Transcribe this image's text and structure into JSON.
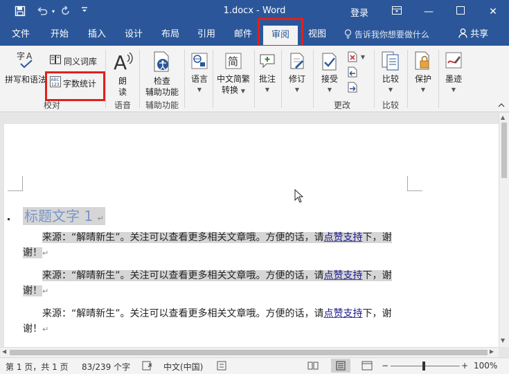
{
  "window": {
    "title": "1.docx  -  Word",
    "login_label": "登录",
    "minimize_glyph": "—",
    "maximize_glyph": "☐",
    "close_glyph": "✕",
    "ribbon_options_glyph": "⊡"
  },
  "quick_access": {
    "save_icon": "save-icon",
    "undo_icon": "undo-icon",
    "redo_icon": "redo-icon",
    "customize_icon": "customize-icon"
  },
  "tabs": [
    {
      "label": "文件"
    },
    {
      "label": "开始"
    },
    {
      "label": "插入"
    },
    {
      "label": "设计"
    },
    {
      "label": "布局"
    },
    {
      "label": "引用"
    },
    {
      "label": "邮件"
    },
    {
      "label": "审阅",
      "active": true
    },
    {
      "label": "视图"
    }
  ],
  "tellme": {
    "label": "告诉我你想要做什么"
  },
  "share": {
    "label": "共享"
  },
  "ribbon": {
    "groups": {
      "proofing": {
        "label": "校对",
        "spelling": "拼写和语法",
        "thesaurus": "同义词库",
        "wordcount": "字数统计"
      },
      "speech": {
        "label": "语音",
        "read_aloud_line1": "朗",
        "read_aloud_line2": "读"
      },
      "accessibility": {
        "label": "辅助功能",
        "check_line1": "检查",
        "check_line2": "辅助功能"
      },
      "language": {
        "label": "语言"
      },
      "chinese": {
        "label_line1": "中文简繁",
        "label_line2": "转换"
      },
      "comments": {
        "label": "批注"
      },
      "tracking": {
        "label": "修订"
      },
      "changes": {
        "label": "更改",
        "accept": "接受"
      },
      "compare": {
        "label": "比较",
        "compare_button": "比较"
      },
      "protect": {
        "label": "保护"
      },
      "ink": {
        "label": "墨迹"
      }
    }
  },
  "document": {
    "heading": "标题文字 1",
    "paragraphs": [
      {
        "pre": "来源：“解晴新生”。关注可以查看更多相关文章哦。方便的话，请",
        "link": "点赞支持",
        "post": "下，谢",
        "line2": "谢！"
      },
      {
        "pre": "来源：“解晴新生”。关注可以查看更多相关文章哦。方便的话，请",
        "link": "点赞支持",
        "post": "下，谢",
        "line2": "谢！"
      },
      {
        "pre": "来源：“解晴新生”。关注可以查看更多相关文章哦。方便的话，请",
        "link": "点赞支持",
        "post": "下，谢",
        "line2": "谢！"
      }
    ],
    "para_mark": "↵"
  },
  "status": {
    "page": "第 1 页，共 1 页",
    "words": "83/239 个字",
    "language": "中文(中国)",
    "zoom": "100%",
    "zoom_minus": "−",
    "zoom_plus": "+"
  }
}
